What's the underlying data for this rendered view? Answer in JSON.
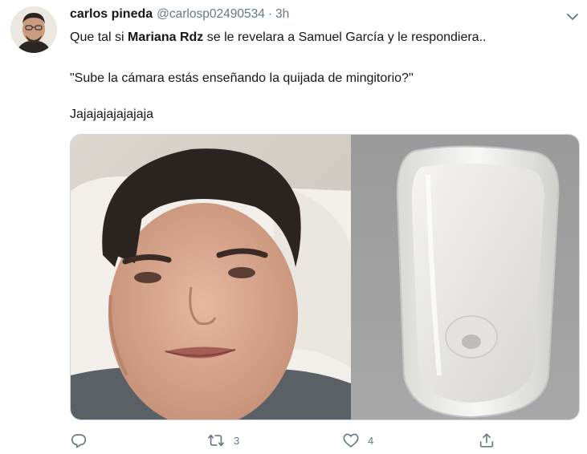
{
  "tweet": {
    "author": {
      "display_name": "carlos pineda",
      "handle": "@carlosp02490534",
      "separator": "·",
      "time": "3h"
    },
    "text": {
      "line1_pre": "Que tal si ",
      "line1_mention": "Mariana Rdz",
      "line1_post": " se le revelara a Samuel García y le respondiera..",
      "line2": "\"Sube la cámara estás enseñando la quijada de mingitorio?\"",
      "line3": "Jajajajajajajaja"
    },
    "actions": {
      "reply_icon": "reply-icon",
      "retweet_icon": "retweet-icon",
      "retweet_count": "3",
      "like_icon": "heart-icon",
      "like_count": "4",
      "share_icon": "share-icon"
    }
  },
  "colors": {
    "text_primary": "#14171a",
    "text_secondary": "#657786",
    "border": "#ccd6dd"
  }
}
